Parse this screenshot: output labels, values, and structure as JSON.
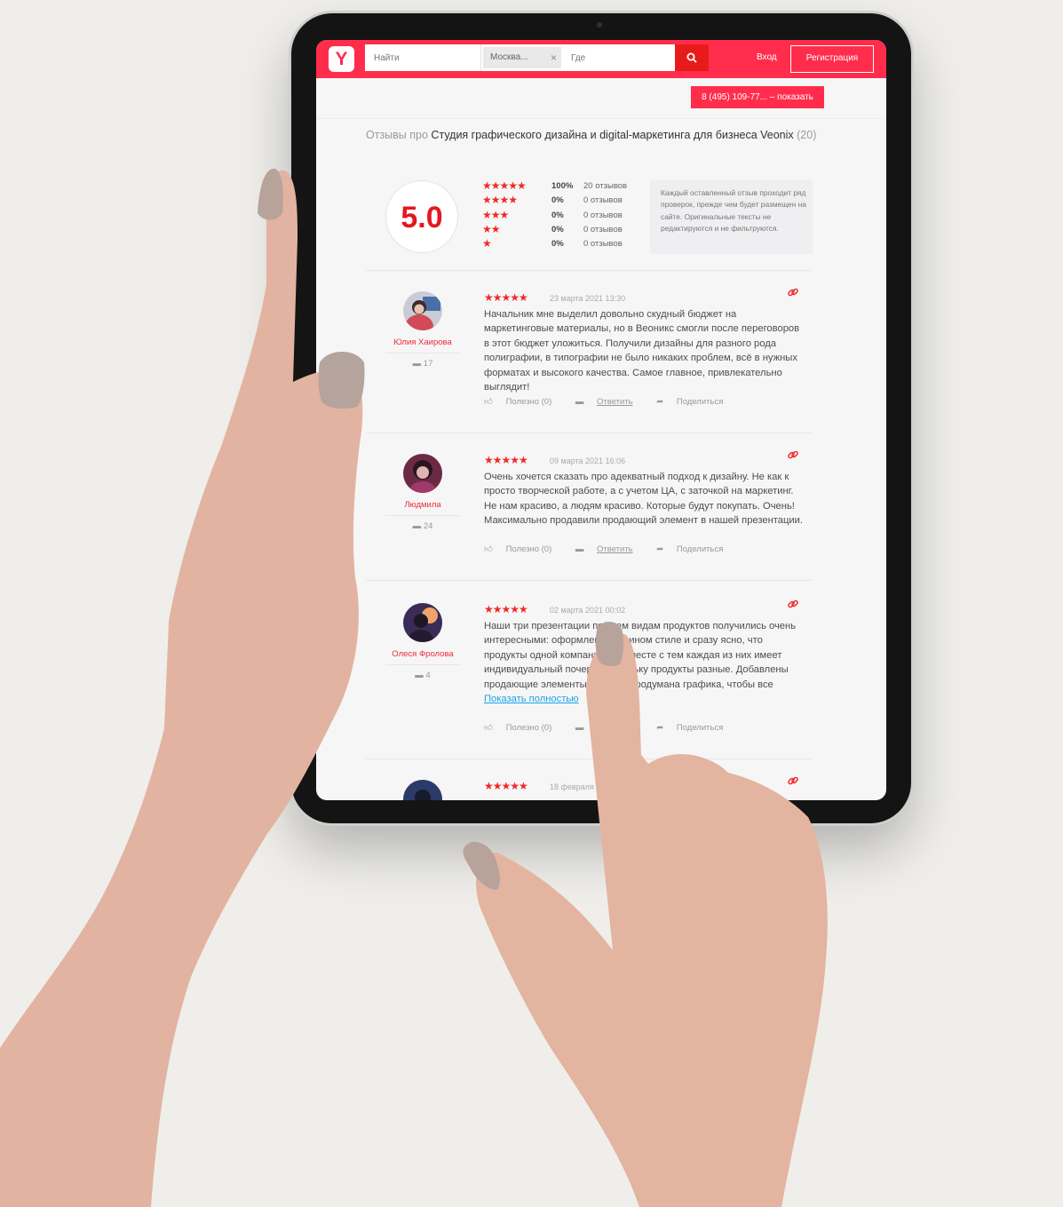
{
  "header": {
    "logo": "Y",
    "search_placeholder": "Найти",
    "city": "Москва...",
    "city_clear": "×",
    "where_placeholder": "Где",
    "login": "Вход",
    "register": "Регистрация",
    "phone": "8 (495) 109-77... – показать"
  },
  "page": {
    "title_prefix": "Отзывы про",
    "title": "Студия графического дизайна и digital-маркетинга для бизнеса Veonix",
    "title_count": "(20)"
  },
  "rating": {
    "score": "5.0",
    "breakdown": [
      {
        "stars": "★★★★★",
        "pct": "100%",
        "count": "20 отзывов"
      },
      {
        "stars": "★★★★",
        "pct": "0%",
        "count": "0 отзывов"
      },
      {
        "stars": "★★★",
        "pct": "0%",
        "count": "0 отзывов"
      },
      {
        "stars": "★★",
        "pct": "0%",
        "count": "0 отзывов"
      },
      {
        "stars": "★",
        "pct": "0%",
        "count": "0 отзывов"
      }
    ],
    "note": "Каждый оставленный отзыв проходит ряд проверок, прежде чем будет размещен на сайте. Оригинальные тексты не редактируются и не фильтруются."
  },
  "reviews": [
    {
      "author": "Юлия Хаирова",
      "comments": "17",
      "stars": "★★★★★",
      "date": "23 марта 2021 13:30",
      "text": "Начальник мне выделил довольно скудный бюджет на маркетинговые материалы, но в Веоникс смогли после переговоров в этот бюджет уложиться. Получили дизайны для разного рода полиграфии, в типографии не было никаких проблем, всё в нужных форматах и высокого качества. Самое главное, привлекательно выглядит!",
      "useful": "Полезно (0)",
      "reply": "Ответить",
      "share": "Поделиться"
    },
    {
      "author": "Людмила",
      "comments": "24",
      "stars": "★★★★★",
      "date": "09 марта 2021 16:06",
      "text": "Очень хочется сказать про адекватный подход к дизайну. Не как к просто творческой работе, а с учетом ЦА, с заточкой на маркетинг. Не нам красиво, а людям красиво. Которые будут покупать. Очень! Максимально продавили продающий элемент в нашей презентации.",
      "useful": "Полезно (0)",
      "reply": "Ответить",
      "share": "Поделиться"
    },
    {
      "author": "Олеся Фролова",
      "comments": "4",
      "stars": "★★★★★",
      "date": "02 марта 2021 00:02",
      "text": "Наши три презентации по всем видам продуктов получились очень интересными: оформлены в едином стиле и сразу ясно, что продукты одной компании, но вместе с тем каждая из них имеет индивидуальный почерк, поскольку продукты разные. Добавлены продающие элементы, хорошо продумана графика, чтобы все",
      "more": "Показать полностью",
      "useful": "Полезно (0)",
      "reply": "Ответить",
      "share": "Поделиться"
    },
    {
      "stars": "★★★★★",
      "date": "18 февраля 2021"
    }
  ],
  "colors": {
    "brand": "#ff2d4b",
    "star": "#ef2a2a",
    "link": "#1aa3e8"
  }
}
